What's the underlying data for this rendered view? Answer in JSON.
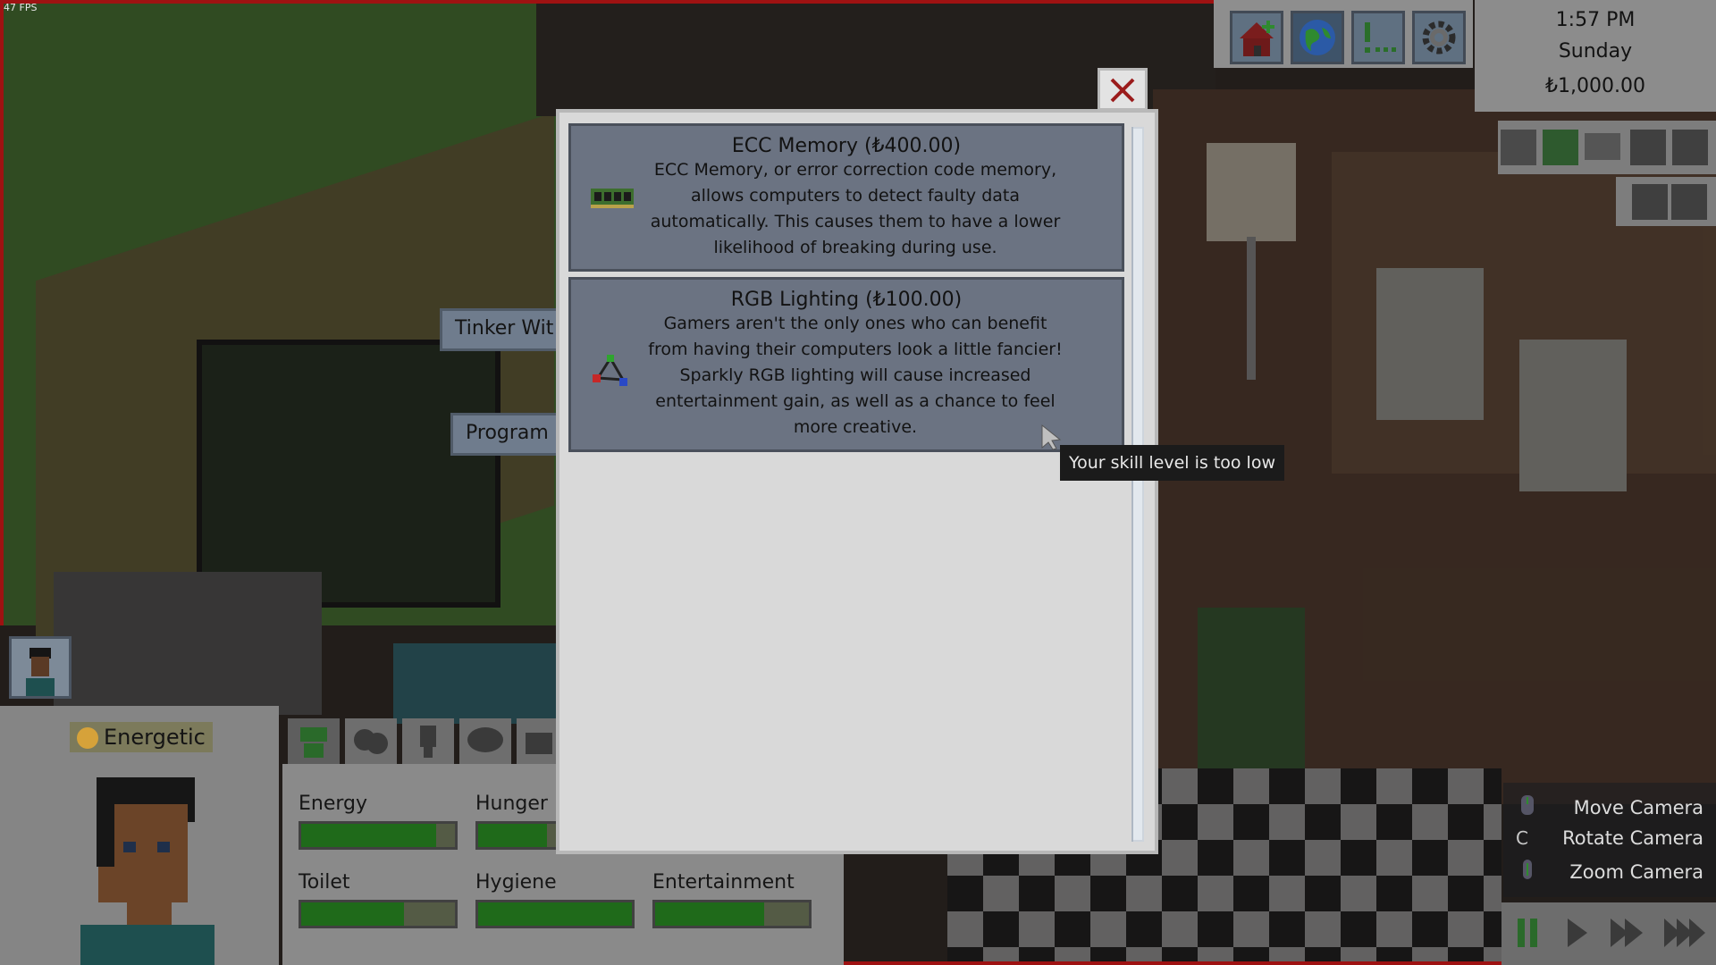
{
  "hud": {
    "fps": "47 FPS",
    "time": "1:57 PM",
    "day": "Sunday",
    "money": "₺1,000.00",
    "toolbar": [
      {
        "icon": "house-add-icon"
      },
      {
        "icon": "globe-icon"
      },
      {
        "icon": "alert-icon"
      },
      {
        "icon": "gear-icon"
      }
    ],
    "camera_controls": [
      {
        "key": "",
        "label": "Move Camera"
      },
      {
        "key": "C",
        "label": "Rotate Camera"
      },
      {
        "key": "",
        "label": "Zoom Camera"
      }
    ]
  },
  "sim": {
    "mood": "Energetic",
    "needs": [
      {
        "label": "Energy",
        "value": 0.88
      },
      {
        "label": "Hunger",
        "value": 0.45
      },
      {
        "label": "Toilet",
        "value": 0.67
      },
      {
        "label": "Hygiene",
        "value": 1.0
      },
      {
        "label": "Entertainment",
        "value": 0.71
      }
    ]
  },
  "context_menu": {
    "tinker": "Tinker Wit",
    "program": "Program"
  },
  "modal": {
    "upgrades": [
      {
        "title": "ECC Memory (₺400.00)",
        "description": "ECC Memory, or error correction code memory, allows computers to detect faulty data automatically. This causes them to have a lower likelihood of breaking during use.",
        "icon": "memory-chip-icon"
      },
      {
        "title": "RGB Lighting (₺100.00)",
        "description": "Gamers aren't the only ones who can benefit from having their computers look a little fancier! Sparkly RGB lighting will cause increased entertainment gain, as well as a chance to feel more creative.",
        "icon": "rgb-lighting-icon"
      }
    ],
    "tooltip": "Your skill level is too low"
  },
  "colors": {
    "need_fill": "#1f6a1a",
    "card_bg": "#6b7382",
    "close_x": "#9b1b1b"
  }
}
